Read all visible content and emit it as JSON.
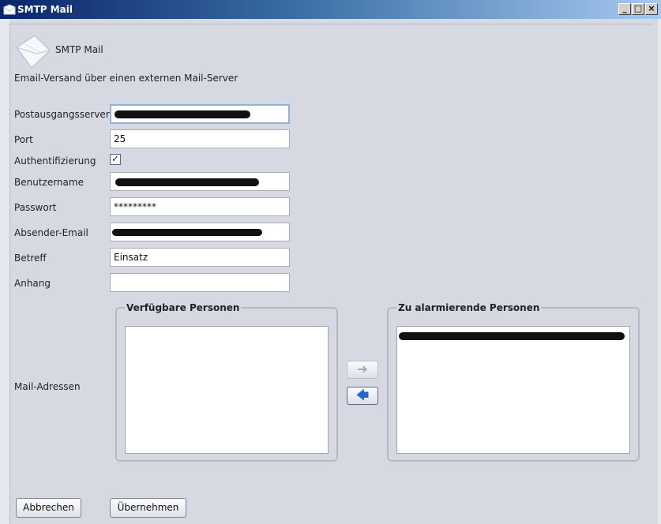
{
  "window": {
    "title": "SMTP Mail",
    "controls": {
      "minimize": "_",
      "maximize": "□",
      "close": "×"
    }
  },
  "header": {
    "icon": "envelope-icon",
    "title": "SMTP Mail",
    "description": "Email-Versand über einen externen Mail-Server"
  },
  "form": {
    "server_label": "Postausgangsserver",
    "port_label": "Port",
    "port_value": "25",
    "auth_label": "Authentifizierung",
    "auth_check": "✓",
    "username_label": "Benutzername",
    "password_label": "Passwort",
    "password_value": "*********",
    "sender_label": "Absender-Email",
    "subject_label": "Betreff",
    "subject_value": "Einsatz",
    "attachment_label": "Anhang",
    "attachment_value": "",
    "mail_label": "Mail-Adressen"
  },
  "panels": {
    "available_title": "Verfügbare Personen",
    "alarm_title": "Zu alarmierende Personen",
    "add_arrow": "➔",
    "remove_arrow": "🡄"
  },
  "buttons": {
    "cancel": "Abbrechen",
    "apply": "Übernehmen"
  }
}
